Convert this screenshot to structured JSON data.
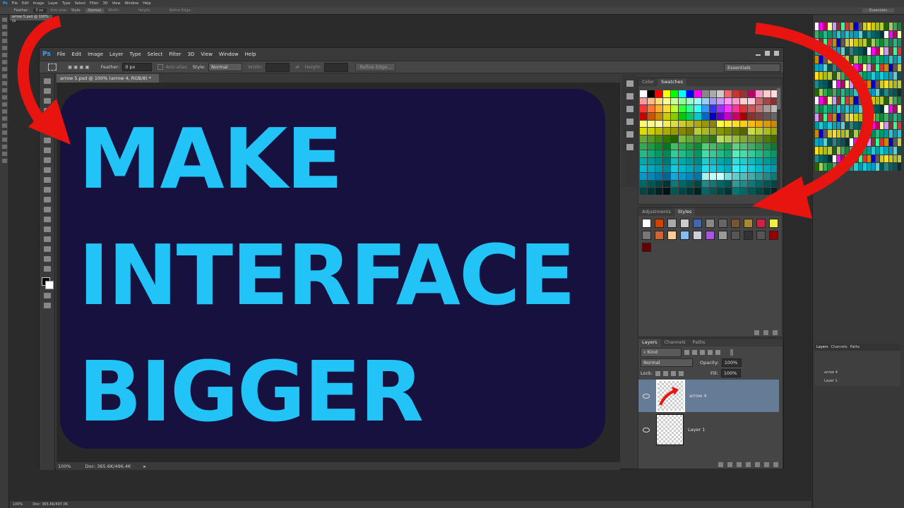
{
  "bg": {
    "menu": [
      "Ps",
      "File",
      "Edit",
      "Image",
      "Layer",
      "Type",
      "Select",
      "Filter",
      "3D",
      "View",
      "Window",
      "Help"
    ],
    "feather_label": "Feather:",
    "feather_value": "0 px",
    "anti_alias": "Anti-alias",
    "style_label": "Style:",
    "style_value": "Normal",
    "width_label": "Width:",
    "height_label": "Height:",
    "refine": "Refine Edge...",
    "essentials": "Essentials",
    "doc_tab": "arrow 5.psd @ 100% (a",
    "status": "Doc: 365.6K/497.0K",
    "layers_tabs": [
      "Layers",
      "Channels",
      "Paths"
    ],
    "layer1": "arrow 4",
    "layer2": "Layer 1"
  },
  "app": {
    "logo": "Ps",
    "menu": [
      "File",
      "Edit",
      "Image",
      "Layer",
      "Type",
      "Select",
      "Filter",
      "3D",
      "View",
      "Window",
      "Help"
    ]
  },
  "options": {
    "feather_label": "Feather:",
    "feather_value": "0 px",
    "anti_alias": "Anti-alias",
    "style_label": "Style:",
    "style_value": "Normal",
    "width_label": "Width:",
    "height_label": "Height:",
    "refine": "Refine Edge...",
    "workspace": "Essentials"
  },
  "document": {
    "tab": "arrow 5.psd @ 100% (arrow 4, RGB/8) *",
    "zoom": "100%",
    "doc_size": "Doc: 365.6K/496.4K"
  },
  "canvas": {
    "line1": "MAKE",
    "line2": "INTERFACE",
    "line3": "BIGGER",
    "text_color": "#22c3f7",
    "bg_color": "#171140"
  },
  "color_panel": {
    "tabs": [
      "Color",
      "Swatches"
    ],
    "active": "Swatches"
  },
  "adjust_panel": {
    "tabs": [
      "Adjustments",
      "Styles"
    ],
    "active": "Styles"
  },
  "layers_panel": {
    "tabs": [
      "Layers",
      "Channels",
      "Paths"
    ],
    "kind": "Kind",
    "blend": "Normal",
    "opacity_label": "Opacity:",
    "opacity": "100%",
    "lock_label": "Lock:",
    "fill_label": "Fill:",
    "fill": "100%",
    "layers": [
      {
        "name": "arrow 4",
        "selected": true
      },
      {
        "name": "Layer 1",
        "selected": false
      }
    ]
  },
  "arrow_color": "#e8140f"
}
